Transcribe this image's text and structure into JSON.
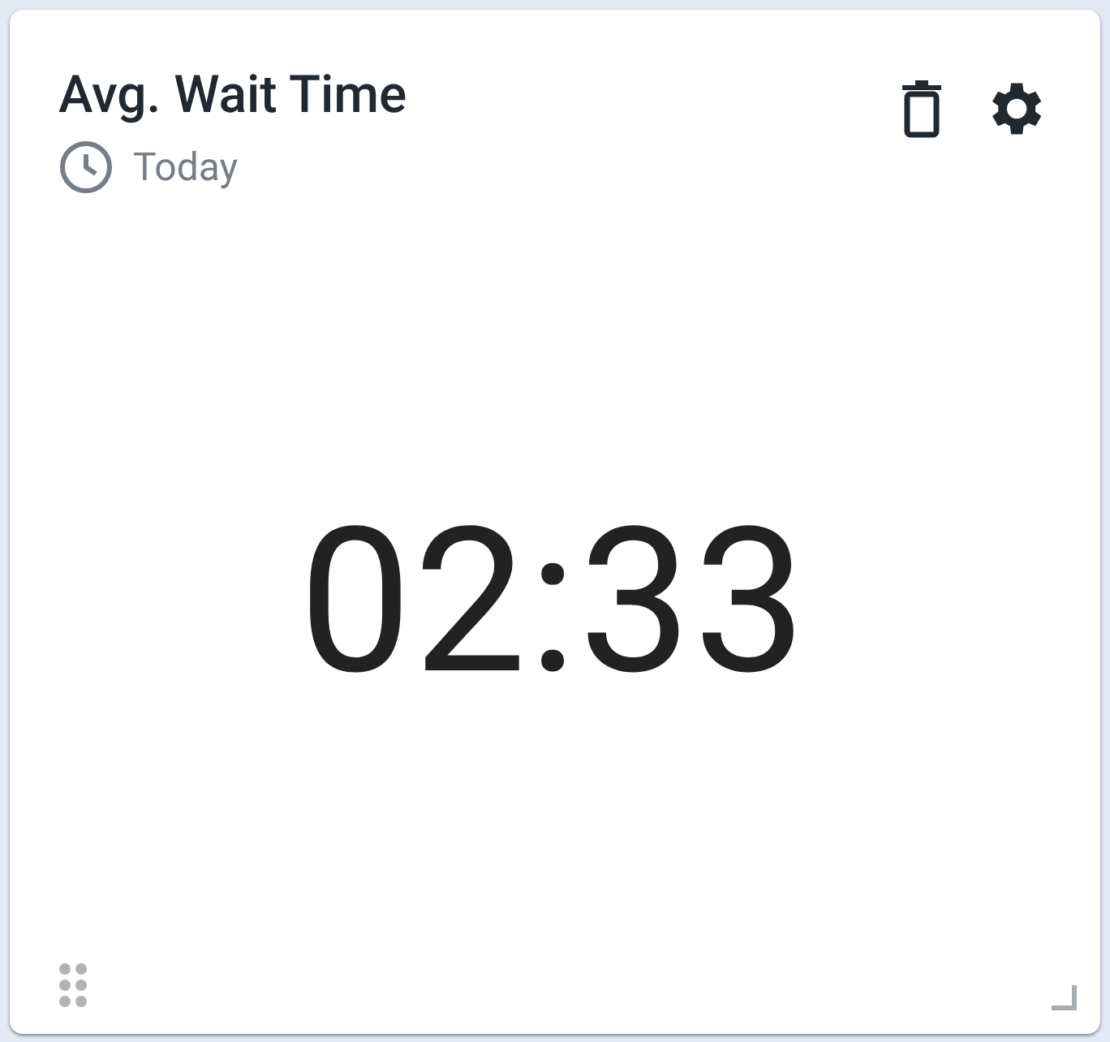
{
  "widget": {
    "title": "Avg. Wait Time",
    "period": "Today",
    "value": "02:33"
  }
}
